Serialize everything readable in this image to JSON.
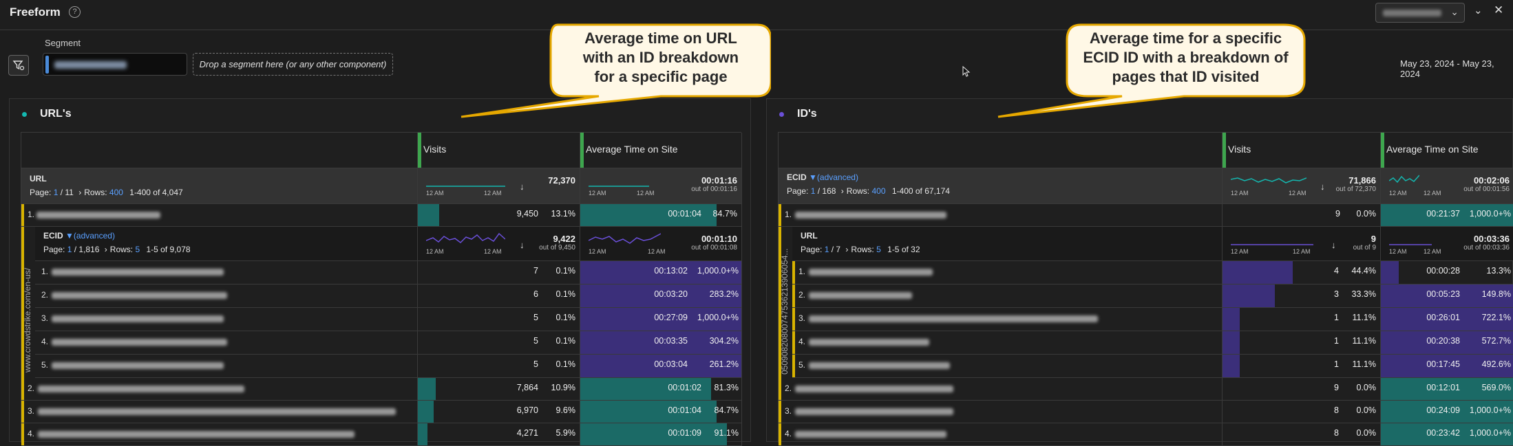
{
  "topbar": {
    "title": "Freeform",
    "help_icon": "?"
  },
  "segment": {
    "label": "Segment",
    "dropzone": "Drop a segment here (or any other component)",
    "date_range": "May 23, 2024 - May 23, 2024"
  },
  "callouts": [
    {
      "lines": [
        "Average time on URL",
        "with an ID breakdown",
        "for a specific page"
      ]
    },
    {
      "lines": [
        "Average time for a specific",
        "ECID ID with a breakdown of",
        "pages that ID visited"
      ]
    }
  ],
  "left_panel": {
    "title": "URL's",
    "dot_color": "#14b8b0",
    "col_visits": "Visits",
    "col_time": "Average Time on Site",
    "dim_label": "URL",
    "page_prefix": "Page:",
    "page_current": "1",
    "page_total": "/ 11",
    "rows_label": "Rows:",
    "rows_value": "400",
    "range": "1-400 of 4,047",
    "visits_total": "72,370",
    "visits_outof": "",
    "time_total": "00:01:16",
    "time_outof": "out of 00:01:16",
    "tick_a": "12 AM",
    "tick_b": "12 AM",
    "row1": {
      "num": "1.",
      "visits": "9,450",
      "visits_pct": "13.1%",
      "time": "00:01:04",
      "time_pct": "84.7%",
      "visits_frac": 0.131,
      "time_frac": 0.847
    },
    "sub": {
      "dim_label": "ECID",
      "filter_label": "(advanced)",
      "page_prefix": "Page:",
      "page_current": "1",
      "page_total": "/ 1,816",
      "rows_label": "Rows:",
      "rows_value": "5",
      "range": "1-5 of 9,078",
      "visits_total": "9,422",
      "visits_outof": "out of 9,450",
      "time_total": "00:01:10",
      "time_outof": "out of 00:01:08",
      "vertical_label": "www.crowdstrike.com/en-us/",
      "rows": [
        {
          "num": "1.",
          "visits": "7",
          "visits_pct": "0.1%",
          "time": "00:13:02",
          "time_pct": "1,000.0+%"
        },
        {
          "num": "2.",
          "visits": "6",
          "visits_pct": "0.1%",
          "time": "00:03:20",
          "time_pct": "283.2%"
        },
        {
          "num": "3.",
          "visits": "5",
          "visits_pct": "0.1%",
          "time": "00:27:09",
          "time_pct": "1,000.0+%"
        },
        {
          "num": "4.",
          "visits": "5",
          "visits_pct": "0.1%",
          "time": "00:03:35",
          "time_pct": "304.2%"
        },
        {
          "num": "5.",
          "visits": "5",
          "visits_pct": "0.1%",
          "time": "00:03:04",
          "time_pct": "261.2%"
        }
      ]
    },
    "rows": [
      {
        "num": "2.",
        "visits": "7,864",
        "visits_pct": "10.9%",
        "time": "00:01:02",
        "time_pct": "81.3%",
        "visits_frac": 0.109,
        "time_frac": 0.813
      },
      {
        "num": "3.",
        "visits": "6,970",
        "visits_pct": "9.6%",
        "time": "00:01:04",
        "time_pct": "84.7%",
        "visits_frac": 0.096,
        "time_frac": 0.847
      },
      {
        "num": "4.",
        "visits": "4,271",
        "visits_pct": "5.9%",
        "time": "00:01:09",
        "time_pct": "91.1%",
        "visits_frac": 0.059,
        "time_frac": 0.911
      }
    ]
  },
  "right_panel": {
    "title": "ID's",
    "dot_color": "#6a4fd8",
    "col_visits": "Visits",
    "col_time": "Average Time on Site",
    "dim_label": "ECID",
    "filter_label": "(advanced)",
    "page_prefix": "Page:",
    "page_current": "1",
    "page_total": "/ 168",
    "rows_label": "Rows:",
    "rows_value": "400",
    "range": "1-400 of 67,174",
    "visits_total": "71,866",
    "visits_outof": "out of 72,370",
    "time_total": "00:02:06",
    "time_outof": "out of 00:01:56",
    "tick_a": "12 AM",
    "tick_b": "12 AM",
    "row1": {
      "num": "1.",
      "visits": "9",
      "visits_pct": "0.0%",
      "time": "00:21:37",
      "time_pct": "1,000.0+%"
    },
    "sub": {
      "dim_label": "URL",
      "page_prefix": "Page:",
      "page_current": "1",
      "page_total": "/ 7",
      "rows_label": "Rows:",
      "rows_value": "5",
      "range": "1-5 of 32",
      "visits_total": "9",
      "visits_outof": "out of 9",
      "time_total": "00:03:36",
      "time_outof": "out of 00:03:36",
      "vertical_label": "05090820800747536213906054...",
      "rows": [
        {
          "num": "1.",
          "visits": "4",
          "visits_pct": "44.4%",
          "time": "00:00:28",
          "time_pct": "13.3%",
          "visits_frac": 0.444,
          "time_frac": 0.133
        },
        {
          "num": "2.",
          "visits": "3",
          "visits_pct": "33.3%",
          "time": "00:05:23",
          "time_pct": "149.8%",
          "visits_frac": 0.333,
          "time_frac": 1
        },
        {
          "num": "3.",
          "visits": "1",
          "visits_pct": "11.1%",
          "time": "00:26:01",
          "time_pct": "722.1%",
          "visits_frac": 0.111,
          "time_frac": 1
        },
        {
          "num": "4.",
          "visits": "1",
          "visits_pct": "11.1%",
          "time": "00:20:38",
          "time_pct": "572.7%",
          "visits_frac": 0.111,
          "time_frac": 1
        },
        {
          "num": "5.",
          "visits": "1",
          "visits_pct": "11.1%",
          "time": "00:17:45",
          "time_pct": "492.6%",
          "visits_frac": 0.111,
          "time_frac": 1
        }
      ]
    },
    "rows": [
      {
        "num": "2.",
        "visits": "9",
        "visits_pct": "0.0%",
        "time": "00:12:01",
        "time_pct": "569.0%"
      },
      {
        "num": "3.",
        "visits": "8",
        "visits_pct": "0.0%",
        "time": "00:24:09",
        "time_pct": "1,000.0+%"
      },
      {
        "num": "4.",
        "visits": "8",
        "visits_pct": "0.0%",
        "time": "00:23:42",
        "time_pct": "1,000.0+%"
      }
    ]
  }
}
